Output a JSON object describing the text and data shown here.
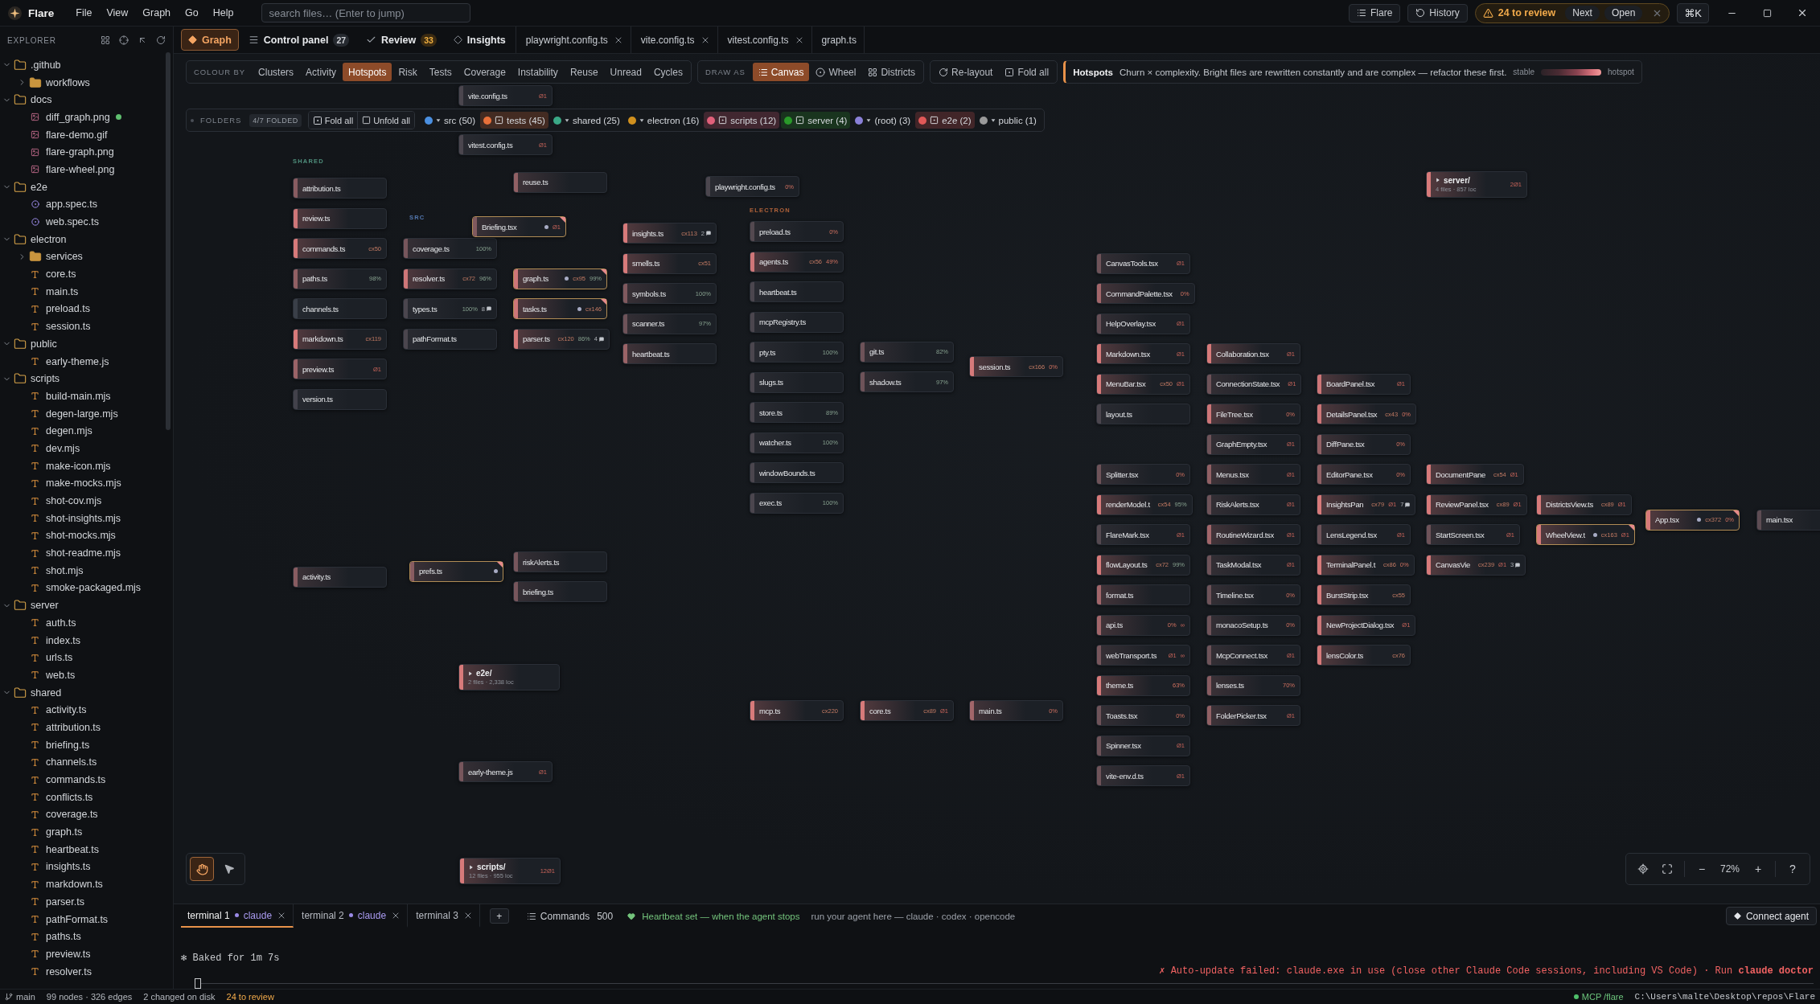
{
  "window": {
    "app_name": "Flare",
    "menu": [
      "File",
      "View",
      "Graph",
      "Go",
      "Help"
    ],
    "search": {
      "placeholder": "search files… (Enter to jump)"
    },
    "workspace_button": "Flare",
    "history_button": "History",
    "review": {
      "label": "24 to review",
      "next": "Next",
      "open": "Open"
    },
    "shortcut": "⌘K"
  },
  "sidebar": {
    "title": "EXPLORER",
    "tree": [
      {
        "name": ".github",
        "kind": "folder",
        "expanded": true,
        "children": [
          {
            "name": "workflows",
            "kind": "folder",
            "expanded": false
          }
        ]
      },
      {
        "name": "docs",
        "kind": "folder",
        "expanded": true,
        "children": [
          {
            "name": "diff_graph.png",
            "kind": "image",
            "changed": true
          },
          {
            "name": "flare-demo.gif",
            "kind": "image",
            "changed": false
          },
          {
            "name": "flare-graph.png",
            "kind": "image",
            "changed": false
          },
          {
            "name": "flare-wheel.png",
            "kind": "image",
            "changed": false
          }
        ]
      },
      {
        "name": "e2e",
        "kind": "folder",
        "expanded": true,
        "children": [
          {
            "name": "app.spec.ts",
            "kind": "test",
            "changed": false
          },
          {
            "name": "web.spec.ts",
            "kind": "test",
            "changed": false
          }
        ]
      },
      {
        "name": "electron",
        "kind": "folder",
        "expanded": true,
        "children": [
          {
            "name": "services",
            "kind": "folder",
            "expanded": false
          },
          {
            "name": "core.ts",
            "kind": "code",
            "changed": false
          },
          {
            "name": "main.ts",
            "kind": "code",
            "changed": false
          },
          {
            "name": "preload.ts",
            "kind": "code",
            "changed": false
          },
          {
            "name": "session.ts",
            "kind": "code",
            "changed": false
          }
        ]
      },
      {
        "name": "public",
        "kind": "folder",
        "expanded": true,
        "children": [
          {
            "name": "early-theme.js",
            "kind": "code",
            "changed": false
          }
        ]
      },
      {
        "name": "scripts",
        "kind": "folder",
        "expanded": true,
        "children": [
          {
            "name": "build-main.mjs",
            "kind": "code",
            "changed": false
          },
          {
            "name": "degen-large.mjs",
            "kind": "code",
            "changed": false
          },
          {
            "name": "degen.mjs",
            "kind": "code",
            "changed": false
          },
          {
            "name": "dev.mjs",
            "kind": "code",
            "changed": false
          },
          {
            "name": "make-icon.mjs",
            "kind": "code",
            "changed": false
          },
          {
            "name": "make-mocks.mjs",
            "kind": "code",
            "changed": false
          },
          {
            "name": "shot-cov.mjs",
            "kind": "code",
            "changed": false
          },
          {
            "name": "shot-insights.mjs",
            "kind": "code",
            "changed": false
          },
          {
            "name": "shot-mocks.mjs",
            "kind": "code",
            "changed": false
          },
          {
            "name": "shot-readme.mjs",
            "kind": "code",
            "changed": false
          },
          {
            "name": "shot.mjs",
            "kind": "code",
            "changed": false
          },
          {
            "name": "smoke-packaged.mjs",
            "kind": "code",
            "changed": false
          }
        ]
      },
      {
        "name": "server",
        "kind": "folder",
        "expanded": true,
        "children": [
          {
            "name": "auth.ts",
            "kind": "code",
            "changed": false
          },
          {
            "name": "index.ts",
            "kind": "code",
            "changed": false
          },
          {
            "name": "urls.ts",
            "kind": "code",
            "changed": false
          },
          {
            "name": "web.ts",
            "kind": "code",
            "changed": false
          }
        ]
      },
      {
        "name": "shared",
        "kind": "folder",
        "expanded": true,
        "children": [
          {
            "name": "activity.ts",
            "kind": "code",
            "changed": false
          },
          {
            "name": "attribution.ts",
            "kind": "code",
            "changed": false
          },
          {
            "name": "briefing.ts",
            "kind": "code",
            "changed": false
          },
          {
            "name": "channels.ts",
            "kind": "code",
            "changed": false
          },
          {
            "name": "commands.ts",
            "kind": "code",
            "changed": false
          },
          {
            "name": "conflicts.ts",
            "kind": "code",
            "changed": false
          },
          {
            "name": "coverage.ts",
            "kind": "code",
            "changed": false
          },
          {
            "name": "graph.ts",
            "kind": "code",
            "changed": false
          },
          {
            "name": "heartbeat.ts",
            "kind": "code",
            "changed": false
          },
          {
            "name": "insights.ts",
            "kind": "code",
            "changed": false
          },
          {
            "name": "markdown.ts",
            "kind": "code",
            "changed": false
          },
          {
            "name": "parser.ts",
            "kind": "code",
            "changed": false
          },
          {
            "name": "pathFormat.ts",
            "kind": "code",
            "changed": false
          },
          {
            "name": "paths.ts",
            "kind": "code",
            "changed": false
          },
          {
            "name": "preview.ts",
            "kind": "code",
            "changed": false
          },
          {
            "name": "resolver.ts",
            "kind": "code",
            "changed": false
          }
        ]
      }
    ]
  },
  "tabs": [
    {
      "label": "Graph",
      "kind": "graph",
      "selected": true,
      "closable": false
    },
    {
      "label": "Control panel",
      "kind": "panel",
      "badge": "27",
      "selected": false,
      "closable": false
    },
    {
      "label": "Review",
      "kind": "review",
      "badge": "33",
      "selected": false,
      "closable": false
    },
    {
      "label": "Insights",
      "kind": "insights",
      "selected": false,
      "closable": false
    },
    {
      "label": "playwright.config.ts",
      "kind": "file",
      "selected": false,
      "closable": true
    },
    {
      "label": "vite.config.ts",
      "kind": "file",
      "selected": false,
      "closable": true
    },
    {
      "label": "vitest.config.ts",
      "kind": "file",
      "selected": false,
      "closable": true
    },
    {
      "label": "graph.ts",
      "kind": "file",
      "selected": false,
      "closable": false
    }
  ],
  "toolbar": {
    "colour_by": {
      "label": "COLOUR BY",
      "options": [
        {
          "label": "Clusters",
          "selected": false
        },
        {
          "label": "Activity",
          "selected": false
        },
        {
          "label": "Hotspots",
          "selected": true
        },
        {
          "label": "Risk",
          "selected": false
        },
        {
          "label": "Tests",
          "selected": false
        },
        {
          "label": "Coverage",
          "selected": false
        },
        {
          "label": "Instability",
          "selected": false
        },
        {
          "label": "Reuse",
          "selected": false
        },
        {
          "label": "Unread",
          "selected": false
        },
        {
          "label": "Cycles",
          "selected": false
        }
      ]
    },
    "draw_as": {
      "label": "DRAW AS",
      "options": [
        {
          "label": "Canvas",
          "kind": "canvas",
          "selected": true
        },
        {
          "label": "Wheel",
          "kind": "wheel",
          "selected": false
        },
        {
          "label": "Districts",
          "kind": "districts",
          "selected": false
        }
      ]
    },
    "actions": [
      {
        "label": "Re-layout",
        "kind": "relayout"
      },
      {
        "label": "Fold all",
        "kind": "fold"
      }
    ],
    "legend": {
      "title": "Hotspots",
      "text": "Churn × complexity. Bright files are rewritten constantly and are complex — refactor these first.",
      "low": "stable",
      "high": "hotspot"
    }
  },
  "folders": {
    "label": "FOLDERS",
    "status": "4/7 FOLDED",
    "actions": [
      {
        "label": "Fold all",
        "kind": "fold"
      },
      {
        "label": "Unfold all",
        "kind": "unfold"
      }
    ],
    "chips": [
      {
        "label": "src (50)",
        "color": "#4a8fe0",
        "folded": false
      },
      {
        "label": "tests (45)",
        "color": "#e8703a",
        "folded": true
      },
      {
        "label": "shared (25)",
        "color": "#3aa886",
        "folded": false
      },
      {
        "label": "electron (16)",
        "color": "#d0901e",
        "folded": false
      },
      {
        "label": "scripts (12)",
        "color": "#e0607a",
        "folded": true
      },
      {
        "label": "server (4)",
        "color": "#2a9a2a",
        "folded": true
      },
      {
        "label": "(root) (3)",
        "color": "#8a80d8",
        "folded": false
      },
      {
        "label": "e2e (2)",
        "color": "#e05858",
        "folded": true
      },
      {
        "label": "public (1)",
        "color": "#9a9a9a",
        "folded": false
      }
    ]
  },
  "graph": {
    "labels": [
      {
        "text": "SHARED",
        "color": "#4f8f7c"
      },
      {
        "text": "SRC",
        "color": "#5478b0"
      },
      {
        "text": "ELECTRON",
        "color": "#b0623a"
      }
    ],
    "nodes": [
      {
        "name": "vite.config.ts",
        "kind": "file",
        "color": "#4b464e",
        "highlighted": false,
        "metrics": [
          {
            "kind": "issues",
            "text": "Ø1"
          }
        ]
      },
      {
        "name": "vitest.config.ts",
        "kind": "file",
        "color": "#4b464e",
        "highlighted": false,
        "metrics": [
          {
            "kind": "issues",
            "text": "Ø1"
          }
        ]
      },
      {
        "name": "attribution.ts",
        "kind": "file",
        "color": "#885c61",
        "highlighted": false
      },
      {
        "name": "review.ts",
        "kind": "file",
        "color": "#ce7678",
        "highlighted": false
      },
      {
        "name": "commands.ts",
        "kind": "file",
        "color": "#d77a7a",
        "highlighted": false,
        "metrics": [
          {
            "kind": "complexity",
            "text": "cx50"
          }
        ]
      },
      {
        "name": "paths.ts",
        "kind": "file",
        "color": "#916064",
        "highlighted": false,
        "metrics": [
          {
            "kind": "coverage_good",
            "text": "98%"
          }
        ]
      },
      {
        "name": "channels.ts",
        "kind": "file",
        "color": "#3a3f48",
        "highlighted": false
      },
      {
        "name": "markdown.ts",
        "kind": "file",
        "color": "#d77a7a",
        "highlighted": false,
        "metrics": [
          {
            "kind": "complexity",
            "text": "cx119"
          }
        ]
      },
      {
        "name": "preview.ts",
        "kind": "file",
        "color": "#9a6367",
        "highlighted": false,
        "metrics": [
          {
            "kind": "issues",
            "text": "Ø1"
          }
        ]
      },
      {
        "name": "version.ts",
        "kind": "file",
        "color": "#43424b",
        "highlighted": false
      },
      {
        "name": "activity.ts",
        "kind": "file",
        "color": "#885c61",
        "highlighted": false
      },
      {
        "name": "coverage.ts",
        "kind": "file",
        "color": "#77565c",
        "highlighted": false,
        "metrics": [
          {
            "kind": "coverage_good",
            "text": "100%"
          }
        ]
      },
      {
        "name": "Briefing.tsx",
        "kind": "file",
        "color": "#80595e",
        "highlighted": true,
        "metrics": [
          {
            "kind": "issues",
            "text": "Ø1"
          }
        ]
      },
      {
        "name": "resolver.ts",
        "kind": "file",
        "color": "#ce7678",
        "highlighted": false,
        "metrics": [
          {
            "kind": "complexity",
            "text": "cx72"
          },
          {
            "kind": "coverage_good",
            "text": "96%"
          }
        ]
      },
      {
        "name": "types.ts",
        "kind": "file",
        "color": "#4b464e",
        "highlighted": false,
        "metrics": [
          {
            "kind": "coverage_good",
            "text": "100%"
          },
          {
            "kind": "comments",
            "text": "8"
          }
        ]
      },
      {
        "name": "pathFormat.ts",
        "kind": "file",
        "color": "#4b464e",
        "highlighted": false
      },
      {
        "name": "prefs.ts",
        "kind": "file",
        "color": "#885c61",
        "highlighted": true
      },
      {
        "name": "reuse.ts",
        "kind": "file",
        "color": "#916064",
        "highlighted": false
      },
      {
        "name": "graph.ts",
        "kind": "file",
        "color": "#ce7678",
        "highlighted": true,
        "metrics": [
          {
            "kind": "complexity",
            "text": "cx95"
          },
          {
            "kind": "coverage_good",
            "text": "99%"
          }
        ]
      },
      {
        "name": "tasks.ts",
        "kind": "file",
        "color": "#ce7678",
        "highlighted": true,
        "metrics": [
          {
            "kind": "complexity",
            "text": "cx146"
          }
        ]
      },
      {
        "name": "parser.ts",
        "kind": "file",
        "color": "#d77a7a",
        "highlighted": false,
        "metrics": [
          {
            "kind": "complexity",
            "text": "cx120"
          },
          {
            "kind": "coverage_good",
            "text": "86%"
          },
          {
            "kind": "comments",
            "text": "4"
          }
        ]
      },
      {
        "name": "riskAlerts.ts",
        "kind": "file",
        "color": "#77565c",
        "highlighted": false
      },
      {
        "name": "briefing.ts",
        "kind": "file",
        "color": "#77565c",
        "highlighted": false
      },
      {
        "name": "insights.ts",
        "kind": "file",
        "color": "#d77a7a",
        "highlighted": false,
        "metrics": [
          {
            "kind": "complexity",
            "text": "cx113"
          },
          {
            "kind": "comments",
            "text": "2"
          }
        ]
      },
      {
        "name": "smells.ts",
        "kind": "file",
        "color": "#d77a7a",
        "highlighted": false,
        "metrics": [
          {
            "kind": "complexity",
            "text": "cx51"
          }
        ]
      },
      {
        "name": "symbols.ts",
        "kind": "file",
        "color": "#80595e",
        "highlighted": false,
        "metrics": [
          {
            "kind": "coverage_good",
            "text": "100%"
          }
        ]
      },
      {
        "name": "scanner.ts",
        "kind": "file",
        "color": "#6e5359",
        "highlighted": false,
        "metrics": [
          {
            "kind": "coverage_good",
            "text": "97%"
          }
        ]
      },
      {
        "name": "heartbeat.ts",
        "kind": "file",
        "color": "#9a6367",
        "highlighted": false
      },
      {
        "name": "playwright.config.ts",
        "kind": "file",
        "color": "#4b464e",
        "highlighted": false,
        "metrics": [
          {
            "kind": "coverage_poor",
            "text": "0%"
          }
        ]
      },
      {
        "name": "preload.ts",
        "kind": "file",
        "color": "#544950",
        "highlighted": false,
        "metrics": [
          {
            "kind": "coverage_poor",
            "text": "0%"
          }
        ]
      },
      {
        "name": "agents.ts",
        "kind": "file",
        "color": "#ce7678",
        "highlighted": false,
        "metrics": [
          {
            "kind": "complexity",
            "text": "cx56"
          },
          {
            "kind": "coverage_poor",
            "text": "49%"
          }
        ]
      },
      {
        "name": "heartbeat.ts",
        "kind": "file",
        "color": "#4b464e",
        "highlighted": false
      },
      {
        "name": "mcpRegistry.ts",
        "kind": "file",
        "color": "#4b464e",
        "highlighted": false
      },
      {
        "name": "pty.ts",
        "kind": "file",
        "color": "#4b464e",
        "highlighted": false,
        "metrics": [
          {
            "kind": "coverage_good",
            "text": "100%"
          }
        ]
      },
      {
        "name": "slugs.ts",
        "kind": "file",
        "color": "#4b464e",
        "highlighted": false
      },
      {
        "name": "store.ts",
        "kind": "file",
        "color": "#4b464e",
        "highlighted": false,
        "metrics": [
          {
            "kind": "coverage_good",
            "text": "89%"
          }
        ]
      },
      {
        "name": "watcher.ts",
        "kind": "file",
        "color": "#4b464e",
        "highlighted": false,
        "metrics": [
          {
            "kind": "coverage_good",
            "text": "100%"
          }
        ]
      },
      {
        "name": "windowBounds.ts",
        "kind": "file",
        "color": "#4b464e",
        "highlighted": false
      },
      {
        "name": "exec.ts",
        "kind": "file",
        "color": "#4b464e",
        "highlighted": false,
        "metrics": [
          {
            "kind": "coverage_good",
            "text": "100%"
          }
        ]
      },
      {
        "name": "git.ts",
        "kind": "file",
        "color": "#6e5359",
        "highlighted": false,
        "metrics": [
          {
            "kind": "coverage_good",
            "text": "82%"
          }
        ]
      },
      {
        "name": "shadow.ts",
        "kind": "file",
        "color": "#6e5359",
        "highlighted": false,
        "metrics": [
          {
            "kind": "coverage_good",
            "text": "97%"
          }
        ]
      },
      {
        "name": "session.ts",
        "kind": "file",
        "color": "#d77a7a",
        "highlighted": false,
        "metrics": [
          {
            "kind": "complexity",
            "text": "cx166"
          },
          {
            "kind": "coverage_poor",
            "text": "0%"
          }
        ]
      },
      {
        "name": "e2e/",
        "kind": "folder",
        "summary": "2 files · 2,338 loc",
        "color": "#d77a7a",
        "highlighted": false
      },
      {
        "name": "mcp.ts",
        "kind": "file",
        "color": "#d77a7a",
        "highlighted": false,
        "metrics": [
          {
            "kind": "complexity",
            "text": "cx220"
          }
        ]
      },
      {
        "name": "core.ts",
        "kind": "file",
        "color": "#d77a7a",
        "highlighted": false,
        "metrics": [
          {
            "kind": "complexity",
            "text": "cx89"
          },
          {
            "kind": "issues",
            "text": "Ø1"
          }
        ]
      },
      {
        "name": "main.ts",
        "kind": "file",
        "color": "#a2666a",
        "highlighted": false,
        "metrics": [
          {
            "kind": "coverage_poor",
            "text": "0%"
          }
        ]
      },
      {
        "name": "early-theme.js",
        "kind": "file",
        "color": "#77565c",
        "highlighted": false,
        "metrics": [
          {
            "kind": "issues",
            "text": "Ø1"
          }
        ]
      },
      {
        "name": "scripts/",
        "kind": "folder",
        "summary": "12 files · 955 loc",
        "color": "#d77a7a",
        "highlighted": false,
        "metrics": [
          {
            "kind": "issues",
            "text": "12Ø1"
          }
        ]
      },
      {
        "name": "server/",
        "kind": "folder",
        "summary": "4 files · 857 loc",
        "color": "#d77a7a",
        "highlighted": false,
        "metrics": [
          {
            "kind": "issues",
            "text": "2Ø1"
          }
        ]
      },
      {
        "name": "CanvasTools.tsx",
        "kind": "file",
        "color": "#6e5359",
        "highlighted": false,
        "metrics": [
          {
            "kind": "issues",
            "text": "Ø1"
          }
        ]
      },
      {
        "name": "CommandPalette.tsx",
        "kind": "file",
        "color": "#a2666a",
        "highlighted": false,
        "metrics": [
          {
            "kind": "coverage_poor",
            "text": "0%"
          }
        ]
      },
      {
        "name": "HelpOverlay.tsx",
        "kind": "file",
        "color": "#664f56",
        "highlighted": false,
        "metrics": [
          {
            "kind": "issues",
            "text": "Ø1"
          }
        ]
      },
      {
        "name": "Markdown.tsx",
        "kind": "file",
        "color": "#d77a7a",
        "highlighted": false,
        "metrics": [
          {
            "kind": "issues",
            "text": "Ø1"
          }
        ]
      },
      {
        "name": "MenuBar.tsx",
        "kind": "file",
        "color": "#d77a7a",
        "highlighted": false,
        "metrics": [
          {
            "kind": "complexity",
            "text": "cx50"
          },
          {
            "kind": "issues",
            "text": "Ø1"
          }
        ]
      },
      {
        "name": "layout.ts",
        "kind": "file",
        "color": "#4b464e",
        "highlighted": false
      },
      {
        "name": "Splitter.tsx",
        "kind": "file",
        "color": "#6e5359",
        "highlighted": false,
        "metrics": [
          {
            "kind": "coverage_poor",
            "text": "0%"
          }
        ]
      },
      {
        "name": "renderModel.t",
        "kind": "file",
        "color": "#d77a7a",
        "highlighted": false,
        "metrics": [
          {
            "kind": "complexity",
            "text": "cx54"
          },
          {
            "kind": "coverage_good",
            "text": "95%"
          }
        ]
      },
      {
        "name": "FlareMark.tsx",
        "kind": "file",
        "color": "#544950",
        "highlighted": false,
        "metrics": [
          {
            "kind": "issues",
            "text": "Ø1"
          }
        ]
      },
      {
        "name": "flowLayout.ts",
        "kind": "file",
        "color": "#d77a7a",
        "highlighted": false,
        "metrics": [
          {
            "kind": "complexity",
            "text": "cx72"
          },
          {
            "kind": "coverage_good",
            "text": "99%"
          }
        ]
      },
      {
        "name": "format.ts",
        "kind": "file",
        "color": "#a2666a",
        "highlighted": false
      },
      {
        "name": "api.ts",
        "kind": "file",
        "color": "#a2666a",
        "highlighted": false,
        "metrics": [
          {
            "kind": "coverage_poor",
            "text": "0%"
          },
          {
            "kind": "linked",
            "text": "∞"
          }
        ]
      },
      {
        "name": "webTransport.ts",
        "kind": "file",
        "color": "#77565c",
        "highlighted": false,
        "metrics": [
          {
            "kind": "issues",
            "text": "Ø1"
          },
          {
            "kind": "linked",
            "text": "∞"
          }
        ]
      },
      {
        "name": "theme.ts",
        "kind": "file",
        "color": "#d77a7a",
        "highlighted": false,
        "metrics": [
          {
            "kind": "coverage_poor",
            "text": "63%"
          }
        ]
      },
      {
        "name": "Toasts.tsx",
        "kind": "file",
        "color": "#6e5359",
        "highlighted": false,
        "metrics": [
          {
            "kind": "coverage_poor",
            "text": "0%"
          }
        ]
      },
      {
        "name": "Spinner.tsx",
        "kind": "file",
        "color": "#6e5359",
        "highlighted": false,
        "metrics": [
          {
            "kind": "issues",
            "text": "Ø1"
          }
        ]
      },
      {
        "name": "vite-env.d.ts",
        "kind": "file",
        "color": "#6e5359",
        "highlighted": false,
        "metrics": [
          {
            "kind": "issues",
            "text": "Ø1"
          }
        ]
      },
      {
        "name": "Collaboration.tsx",
        "kind": "file",
        "color": "#d77a7a",
        "highlighted": false,
        "metrics": [
          {
            "kind": "issues",
            "text": "Ø1"
          }
        ]
      },
      {
        "name": "ConnectionState.tsx",
        "kind": "file",
        "color": "#6e5359",
        "highlighted": false,
        "metrics": [
          {
            "kind": "issues",
            "text": "Ø1"
          }
        ]
      },
      {
        "name": "FileTree.tsx",
        "kind": "file",
        "color": "#ce7678",
        "highlighted": false,
        "metrics": [
          {
            "kind": "coverage_poor",
            "text": "0%"
          }
        ]
      },
      {
        "name": "GraphEmpty.tsx",
        "kind": "file",
        "color": "#6e5359",
        "highlighted": false,
        "metrics": [
          {
            "kind": "issues",
            "text": "Ø1"
          }
        ]
      },
      {
        "name": "Menus.tsx",
        "kind": "file",
        "color": "#916064",
        "highlighted": false,
        "metrics": [
          {
            "kind": "issues",
            "text": "Ø1"
          }
        ]
      },
      {
        "name": "RiskAlerts.tsx",
        "kind": "file",
        "color": "#6e5359",
        "highlighted": false,
        "metrics": [
          {
            "kind": "issues",
            "text": "Ø1"
          }
        ]
      },
      {
        "name": "RoutineWizard.tsx",
        "kind": "file",
        "color": "#a2666a",
        "highlighted": false,
        "metrics": [
          {
            "kind": "issues",
            "text": "Ø1"
          }
        ]
      },
      {
        "name": "TaskModal.tsx",
        "kind": "file",
        "color": "#6e5359",
        "highlighted": false,
        "metrics": [
          {
            "kind": "issues",
            "text": "Ø1"
          }
        ]
      },
      {
        "name": "Timeline.tsx",
        "kind": "file",
        "color": "#6e5359",
        "highlighted": false,
        "metrics": [
          {
            "kind": "coverage_poor",
            "text": "0%"
          }
        ]
      },
      {
        "name": "monacoSetup.ts",
        "kind": "file",
        "color": "#6e5359",
        "highlighted": false,
        "metrics": [
          {
            "kind": "coverage_poor",
            "text": "0%"
          }
        ]
      },
      {
        "name": "McpConnect.tsx",
        "kind": "file",
        "color": "#6e5359",
        "highlighted": false,
        "metrics": [
          {
            "kind": "issues",
            "text": "Ø1"
          }
        ]
      },
      {
        "name": "lenses.ts",
        "kind": "file",
        "color": "#885c61",
        "highlighted": false,
        "metrics": [
          {
            "kind": "coverage_poor",
            "text": "70%"
          }
        ]
      },
      {
        "name": "FolderPicker.tsx",
        "kind": "file",
        "color": "#916064",
        "highlighted": false,
        "metrics": [
          {
            "kind": "issues",
            "text": "Ø1"
          }
        ]
      },
      {
        "name": "BoardPanel.tsx",
        "kind": "file",
        "color": "#ce7678",
        "highlighted": false,
        "metrics": [
          {
            "kind": "issues",
            "text": "Ø1"
          }
        ]
      },
      {
        "name": "DetailsPanel.tsx",
        "kind": "file",
        "color": "#ce7678",
        "highlighted": false,
        "metrics": [
          {
            "kind": "complexity",
            "text": "cx43"
          },
          {
            "kind": "coverage_poor",
            "text": "0%"
          }
        ]
      },
      {
        "name": "DiffPane.tsx",
        "kind": "file",
        "color": "#916064",
        "highlighted": false,
        "metrics": [
          {
            "kind": "coverage_poor",
            "text": "0%"
          }
        ]
      },
      {
        "name": "EditorPane.tsx",
        "kind": "file",
        "color": "#916064",
        "highlighted": false,
        "metrics": [
          {
            "kind": "coverage_poor",
            "text": "0%"
          }
        ]
      },
      {
        "name": "InsightsPan",
        "kind": "file",
        "color": "#d77a7a",
        "highlighted": false,
        "metrics": [
          {
            "kind": "complexity",
            "text": "cx79"
          },
          {
            "kind": "issues",
            "text": "Ø1"
          },
          {
            "kind": "comments",
            "text": "7"
          }
        ]
      },
      {
        "name": "LensLegend.tsx",
        "kind": "file",
        "color": "#6e5359",
        "highlighted": false,
        "metrics": [
          {
            "kind": "issues",
            "text": "Ø1"
          }
        ]
      },
      {
        "name": "TerminalPanel.t",
        "kind": "file",
        "color": "#d77a7a",
        "highlighted": false,
        "metrics": [
          {
            "kind": "complexity",
            "text": "cx86"
          },
          {
            "kind": "coverage_poor",
            "text": "0%"
          }
        ]
      },
      {
        "name": "BurstStrip.tsx",
        "kind": "file",
        "color": "#d77a7a",
        "highlighted": false,
        "metrics": [
          {
            "kind": "complexity",
            "text": "cx55"
          }
        ]
      },
      {
        "name": "NewProjectDialog.tsx",
        "kind": "file",
        "color": "#ce7678",
        "highlighted": false,
        "metrics": [
          {
            "kind": "issues",
            "text": "Ø1"
          }
        ]
      },
      {
        "name": "lensColor.ts",
        "kind": "file",
        "color": "#d77a7a",
        "highlighted": false,
        "metrics": [
          {
            "kind": "complexity",
            "text": "cx76"
          }
        ]
      },
      {
        "name": "DocumentPane",
        "kind": "file",
        "color": "#d77a7a",
        "highlighted": false,
        "metrics": [
          {
            "kind": "complexity",
            "text": "cx54"
          },
          {
            "kind": "issues",
            "text": "Ø1"
          }
        ]
      },
      {
        "name": "ReviewPanel.tsx",
        "kind": "file",
        "color": "#d77a7a",
        "highlighted": false,
        "metrics": [
          {
            "kind": "complexity",
            "text": "cx89"
          },
          {
            "kind": "issues",
            "text": "Ø1"
          }
        ]
      },
      {
        "name": "StartScreen.tsx",
        "kind": "file",
        "color": "#6e5359",
        "highlighted": false,
        "metrics": [
          {
            "kind": "issues",
            "text": "Ø1"
          }
        ]
      },
      {
        "name": "CanvasVie",
        "kind": "file",
        "color": "#d77a7a",
        "highlighted": false,
        "metrics": [
          {
            "kind": "complexity",
            "text": "cx239"
          },
          {
            "kind": "issues",
            "text": "Ø1"
          },
          {
            "kind": "comments",
            "text": "3"
          }
        ]
      },
      {
        "name": "DistrictsView.ts",
        "kind": "file",
        "color": "#d77a7a",
        "highlighted": false,
        "metrics": [
          {
            "kind": "complexity",
            "text": "cx89"
          },
          {
            "kind": "issues",
            "text": "Ø1"
          }
        ]
      },
      {
        "name": "WheelView.t",
        "kind": "file",
        "color": "#d77a7a",
        "highlighted": true,
        "metrics": [
          {
            "kind": "complexity",
            "text": "cx163"
          },
          {
            "kind": "issues",
            "text": "Ø1"
          }
        ]
      },
      {
        "name": "App.tsx",
        "kind": "file",
        "color": "#d77a7a",
        "highlighted": true,
        "metrics": [
          {
            "kind": "complexity",
            "text": "cx372"
          },
          {
            "kind": "coverage_poor",
            "text": "0%"
          }
        ]
      },
      {
        "name": "main.tsx",
        "kind": "file",
        "color": "#5d4c53",
        "highlighted": false
      }
    ]
  },
  "canvas_tools": [
    {
      "kind": "hand",
      "selected": true
    },
    {
      "kind": "pointer",
      "selected": false
    }
  ],
  "zoom_controls": {
    "out": "−",
    "reading": "72%",
    "in": "+",
    "help": "?"
  },
  "terminal": {
    "tabs": [
      {
        "label": "terminal 1",
        "agent": "claude",
        "selected": true
      },
      {
        "label": "terminal 2",
        "agent": "claude",
        "selected": false
      },
      {
        "label": "terminal 3",
        "selected": false
      }
    ],
    "new_tab": "+",
    "commands": {
      "label": "Commands",
      "count": "500"
    },
    "heartbeat": "Heartbeat set — when the agent stops",
    "hint": "run your agent here — claude · codex · opencode",
    "connect": "Connect agent",
    "output": [
      {
        "kind": "status",
        "text": "✻ Baked for 1m 7s"
      },
      {
        "kind": "error",
        "text": "✗ Auto-update failed: claude.exe in use (close other Claude Code sessions, including VS Code) · Run **claude doctor**"
      }
    ]
  },
  "status_bar": {
    "branch": "main",
    "stats": "99 nodes · 326 edges",
    "changed": "2 changed on disk",
    "review": "24 to review",
    "mcp": "MCP /flare",
    "path": "C:\\Users\\malte\\Desktop\\repos\\Flare"
  }
}
